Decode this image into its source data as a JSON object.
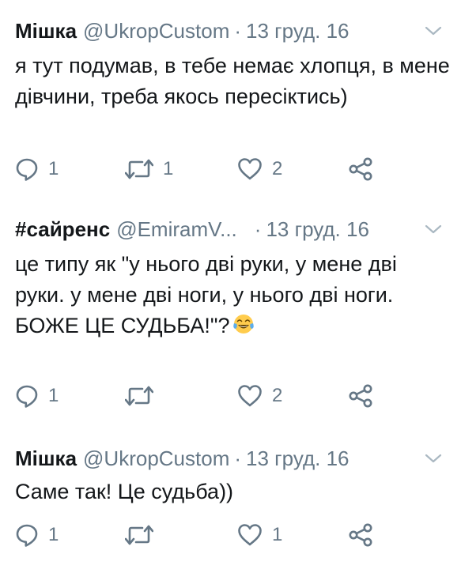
{
  "tweets": [
    {
      "name": "Мішка",
      "handle": "@UkropCustom",
      "sep": "·",
      "date": "13 груд. 16",
      "text": "я тут подумав, в тебе немає хлопця, в мене дівчини, треба якось пересіктись)",
      "replies": "1",
      "retweets": "1",
      "likes": "2"
    },
    {
      "name": "#сайренс",
      "handle": "@EmiramV...",
      "sep": "·",
      "date": "13 груд. 16",
      "text": "це типу як \"у нього дві руки, у мене дві руки. у мене дві ноги, у нього дві ноги. БОЖЕ ЦЕ СУДЬБА!\"?",
      "emoji": "😂",
      "replies": "1",
      "retweets": "",
      "likes": "2"
    },
    {
      "name": "Мішка",
      "handle": "@UkropCustom",
      "sep": "·",
      "date": "13 груд. 16",
      "text": "Саме так! Це судьба))",
      "replies": "1",
      "retweets": "",
      "likes": "1"
    }
  ],
  "icons": {
    "more": "chevron-down-icon",
    "reply": "reply-icon",
    "retweet": "retweet-icon",
    "like": "heart-icon",
    "share": "share-icon"
  },
  "colors": {
    "text": "#14171a",
    "secondary": "#657786",
    "icon": "#657786",
    "emoji_face": "#ffcc4d"
  }
}
